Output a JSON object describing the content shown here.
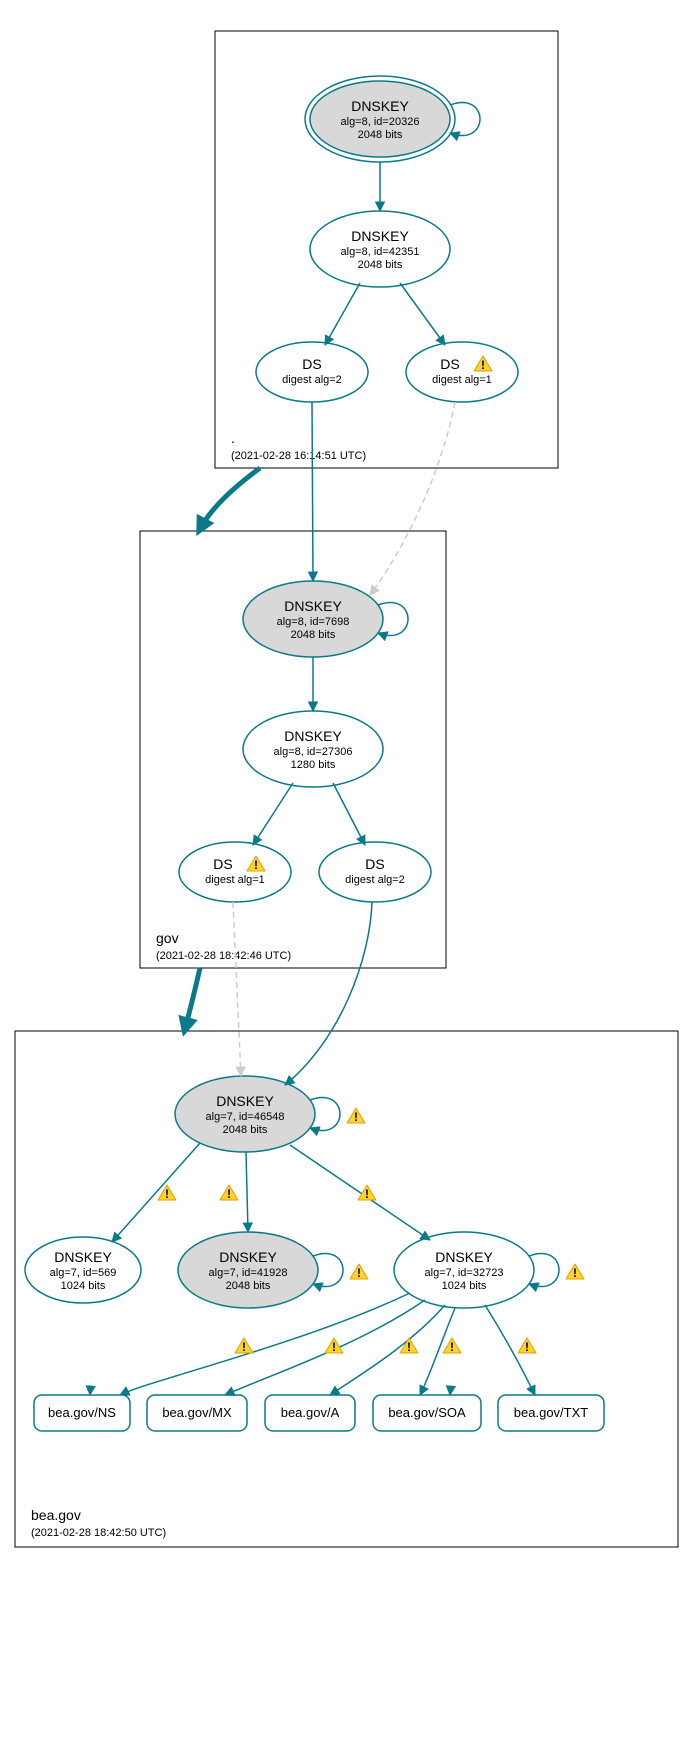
{
  "zones": {
    "root": {
      "label": ".",
      "timestamp": "(2021-02-28 16:14:51 UTC)",
      "nodes": {
        "k20326": {
          "title": "DNSKEY",
          "l1": "alg=8, id=20326",
          "l2": "2048 bits"
        },
        "k42351": {
          "title": "DNSKEY",
          "l1": "alg=8, id=42351",
          "l2": "2048 bits"
        },
        "ds2": {
          "title": "DS",
          "l1": "digest alg=2"
        },
        "ds1": {
          "title": "DS",
          "l1": "digest alg=1"
        }
      }
    },
    "gov": {
      "label": "gov",
      "timestamp": "(2021-02-28 18:42:46 UTC)",
      "nodes": {
        "k7698": {
          "title": "DNSKEY",
          "l1": "alg=8, id=7698",
          "l2": "2048 bits"
        },
        "k27306": {
          "title": "DNSKEY",
          "l1": "alg=8, id=27306",
          "l2": "1280 bits"
        },
        "ds1": {
          "title": "DS",
          "l1": "digest alg=1"
        },
        "ds2": {
          "title": "DS",
          "l1": "digest alg=2"
        }
      }
    },
    "bea": {
      "label": "bea.gov",
      "timestamp": "(2021-02-28 18:42:50 UTC)",
      "nodes": {
        "k46548": {
          "title": "DNSKEY",
          "l1": "alg=7, id=46548",
          "l2": "2048 bits"
        },
        "k569": {
          "title": "DNSKEY",
          "l1": "alg=7, id=569",
          "l2": "1024 bits"
        },
        "k41928": {
          "title": "DNSKEY",
          "l1": "alg=7, id=41928",
          "l2": "2048 bits"
        },
        "k32723": {
          "title": "DNSKEY",
          "l1": "alg=7, id=32723",
          "l2": "1024 bits"
        }
      },
      "leaves": {
        "ns": "bea.gov/NS",
        "mx": "bea.gov/MX",
        "a": "bea.gov/A",
        "soa": "bea.gov/SOA",
        "txt": "bea.gov/TXT"
      }
    }
  }
}
